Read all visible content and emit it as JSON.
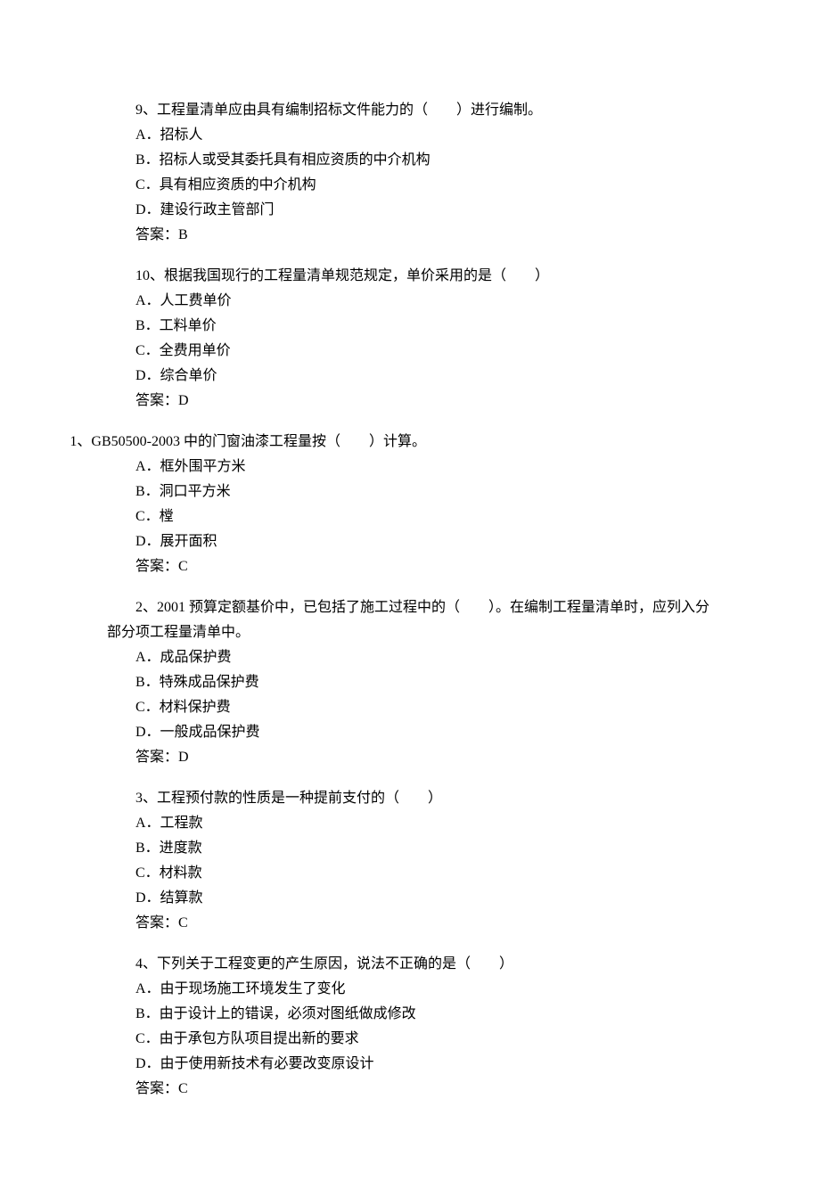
{
  "questions": [
    {
      "stem": "9、工程量清单应由具有编制招标文件能力的（　　）进行编制。",
      "options": [
        "A．招标人",
        "B．招标人或受其委托具有相应资质的中介机构",
        "C．具有相应资质的中介机构",
        "D．建设行政主管部门"
      ],
      "answer": "答案：B"
    },
    {
      "stem": "10、根据我国现行的工程量清单规范规定，单价采用的是（　　）",
      "options": [
        "A．人工费单价",
        "B．工料单价",
        "C．全费用单价",
        "D．综合单价"
      ],
      "answer": "答案：D"
    },
    {
      "stem": "1、GB50500-2003 中的门窗油漆工程量按（　　）计算。",
      "outdent": true,
      "options": [
        "A．框外围平方米",
        "B．洞口平方米",
        "C．樘",
        "D．展开面积"
      ],
      "answer": "答案：C"
    },
    {
      "stem": "2、2001 预算定额基价中，已包括了施工过程中的（　　）。在编制工程量清单时，应列入分部分项工程量清单中。",
      "multilineStem": true,
      "options": [
        "A．成品保护费",
        "B．特殊成品保护费",
        "C．材料保护费",
        "D．一般成品保护费"
      ],
      "answer": "答案：D"
    },
    {
      "stem": "3、工程预付款的性质是一种提前支付的（　　）",
      "options": [
        "A．工程款",
        "B．进度款",
        "C．材料款",
        "D．结算款"
      ],
      "answer": "答案：C"
    },
    {
      "stem": "4、下列关于工程变更的产生原因，说法不正确的是（　　）",
      "options": [
        "A．由于现场施工环境发生了变化",
        "B．由于设计上的错误，必须对图纸做成修改",
        "C．由于承包方队项目提出新的要求",
        "D．由于使用新技术有必要改变原设计"
      ],
      "answer": "答案：C"
    }
  ]
}
